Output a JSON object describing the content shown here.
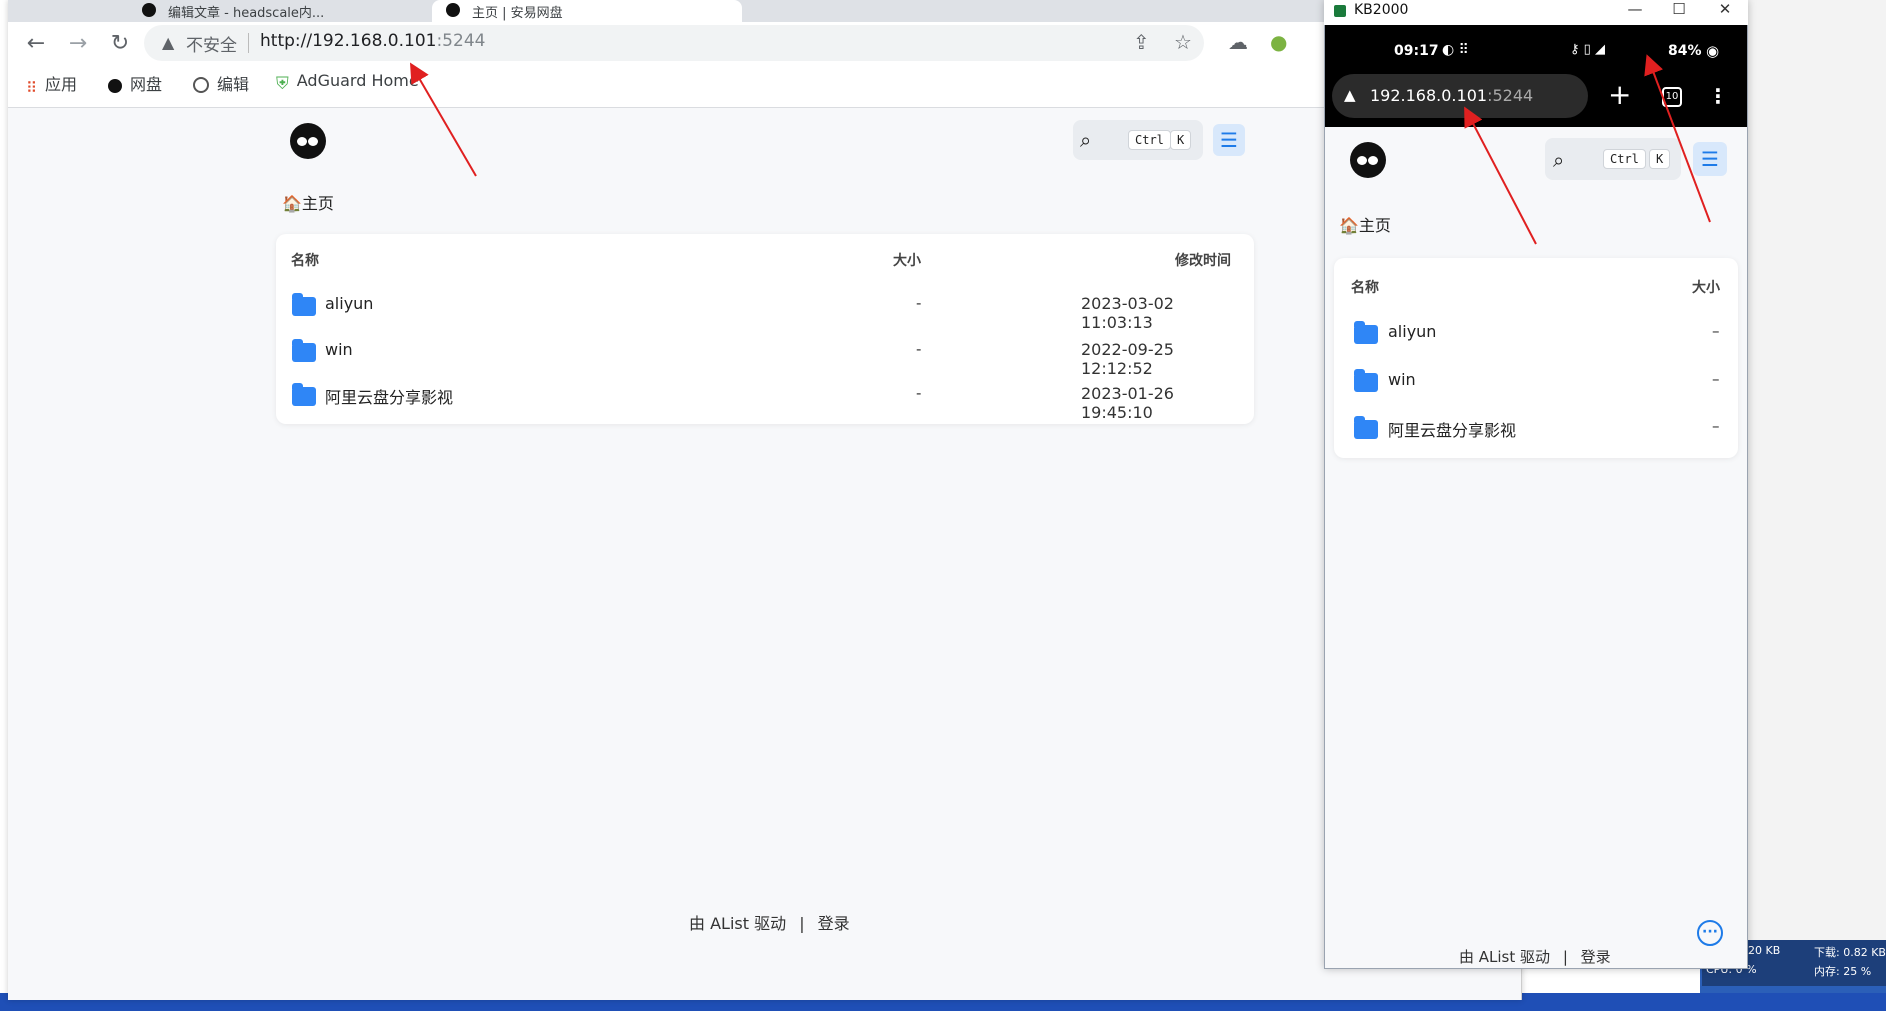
{
  "browser": {
    "tabs": [
      {
        "label": "编辑文章 - headscale内..."
      },
      {
        "label": "主页 | 安易网盘"
      }
    ],
    "omnibox": {
      "security_label": "不安全",
      "url_host": "http://192.168.0.101",
      "url_port": ":5244"
    },
    "bookmarks": [
      {
        "label": "应用",
        "icon": "apps-grid-icon"
      },
      {
        "label": "网盘",
        "icon": "alist-icon"
      },
      {
        "label": "编辑",
        "icon": "wordpress-icon"
      },
      {
        "label": "AdGuard Home",
        "icon": "adguard-shield-icon"
      }
    ]
  },
  "alist": {
    "search": {
      "key1": "Ctrl",
      "key2": "K"
    },
    "breadcrumb": "🏠主页",
    "columns": {
      "name": "名称",
      "size": "大小",
      "modified": "修改时间"
    },
    "files": [
      {
        "name": "aliyun",
        "size": "-",
        "modified": "2023-03-02 11:03:13"
      },
      {
        "name": "win",
        "size": "-",
        "modified": "2022-09-25 12:12:52"
      },
      {
        "name": "阿里云盘分享影视",
        "size": "-",
        "modified": "2023-01-26 19:45:10"
      }
    ],
    "footer": {
      "powered_prefix": "由 AList 驱动",
      "separator": "|",
      "login": "登录"
    }
  },
  "phone": {
    "window_title": "KB2000",
    "status": {
      "time": "09:17",
      "battery": "84%"
    },
    "url_host": "192.168.0.101",
    "url_port": ":5244",
    "tab_count": "10",
    "columns": {
      "name": "名称",
      "size": "大小"
    },
    "files": [
      {
        "name": "aliyun",
        "size": "–"
      },
      {
        "name": "win",
        "size": "–"
      },
      {
        "name": "阿里云盘分享影视",
        "size": "–"
      }
    ],
    "footer": {
      "powered_prefix": "由 AList 驱动",
      "separator": "|",
      "login": "登录"
    }
  },
  "taskbar": {
    "net_up": "20 KB",
    "net_down": "下载: 0.82 KB",
    "cpu": "CPU: 0 %",
    "mem": "内存: 25 %"
  },
  "colors": {
    "accent": "#1e7be8",
    "folder": "#2f86f6",
    "annotation_arrow": "#e02020"
  }
}
